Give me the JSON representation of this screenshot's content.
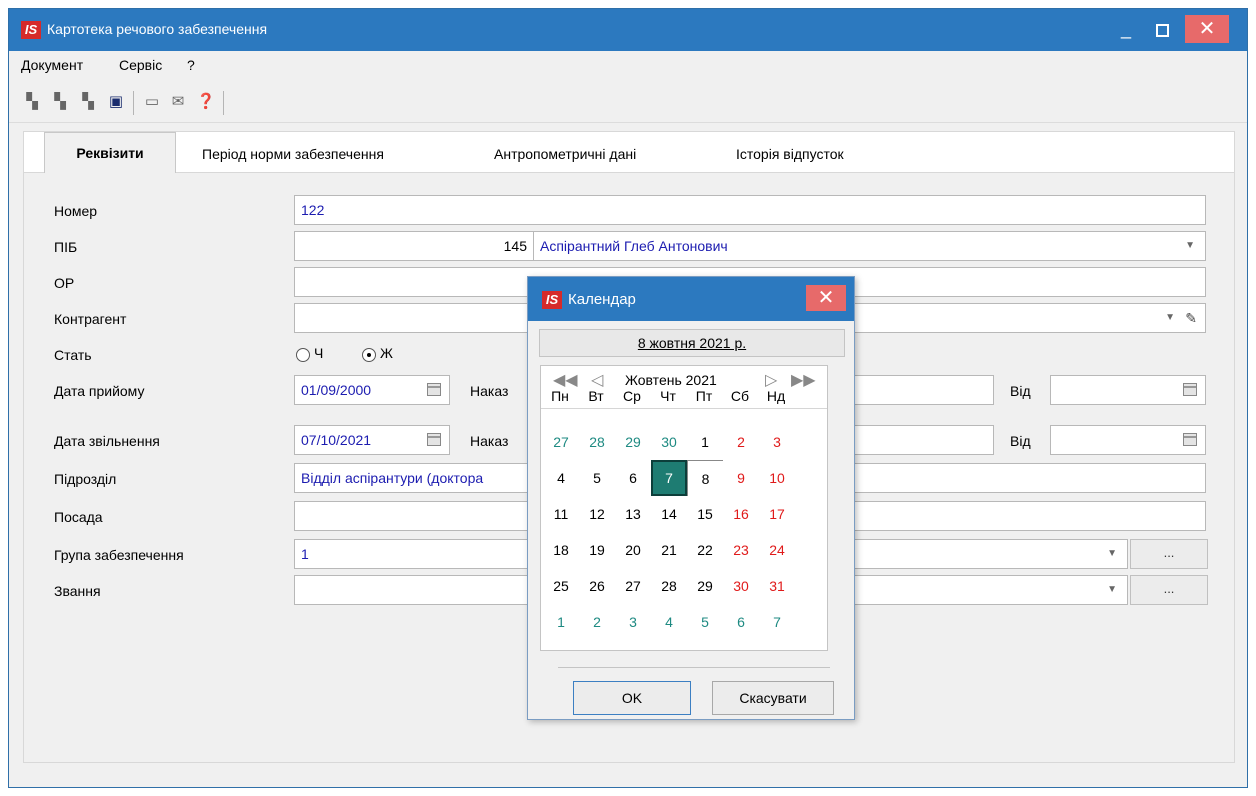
{
  "app": {
    "logo": "IS",
    "title": "Картотека речового забезпечення"
  },
  "menu": [
    "Документ",
    "Сервіс",
    "?"
  ],
  "toolbar_icons": [
    "doc-icon",
    "doc-icon",
    "doc-icon",
    "save-icon",
    "window-icon",
    "mail-icon",
    "help-icon"
  ],
  "tabs": [
    "Реквізити",
    "Період норми забезпечення",
    "Антропометричні дані",
    "Історія відпусток"
  ],
  "form": {
    "number_label": "Номер",
    "number_value": "122",
    "pib_label": "ПІБ",
    "pib_code": "145",
    "pib_name": "Аспірантний Глеб Антонович",
    "or_label": "ОР",
    "contractor_label": "Контрагент",
    "gender_label": "Стать",
    "gender_m": "Ч",
    "gender_f": "Ж",
    "gender_selected": "Ж",
    "hire_label": "Дата прийому",
    "hire_date": "01/09/2000",
    "dismiss_label": "Дата звільнення",
    "dismiss_date": "07/10/2021",
    "order_label": "Наказ",
    "from_label": "Від",
    "dept_label": "Підрозділ",
    "dept_value": "Відділ аспірантури (доктора",
    "position_label": "Посада",
    "group_label": "Група забезпечення",
    "group_value": "1",
    "rank_label": "Звання",
    "dots": "..."
  },
  "calendar": {
    "title": "Календар",
    "today_text": "8 жовтня 2021 р.",
    "month_title": "Жовтень 2021",
    "weekdays": [
      "Пн",
      "Вт",
      "Ср",
      "Чт",
      "Пт",
      "Сб",
      "Нд"
    ],
    "selected_day": "7",
    "ok_label": "OK",
    "cancel_label": "Скасувати",
    "weeks": [
      [
        "27",
        "28",
        "29",
        "30",
        "1",
        "2",
        "3"
      ],
      [
        "4",
        "5",
        "6",
        "7",
        "8",
        "9",
        "10"
      ],
      [
        "11",
        "12",
        "13",
        "14",
        "15",
        "16",
        "17"
      ],
      [
        "18",
        "19",
        "20",
        "21",
        "22",
        "23",
        "24"
      ],
      [
        "25",
        "26",
        "27",
        "28",
        "29",
        "30",
        "31"
      ],
      [
        "1",
        "2",
        "3",
        "4",
        "5",
        "6",
        "7"
      ]
    ]
  },
  "colors": {
    "titlebar": "#2c79bf",
    "close": "#e76a6a",
    "value_text": "#1c1cb0",
    "weekend": "#e01a1a",
    "other_month": "#1e8a82",
    "selected": "#1e7c72"
  }
}
